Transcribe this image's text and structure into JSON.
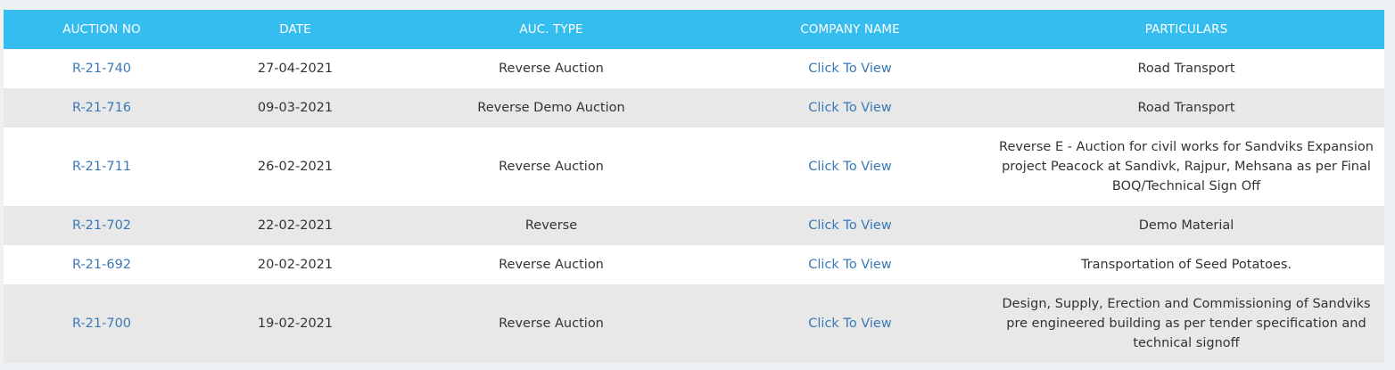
{
  "table": {
    "headers": {
      "auction_no": "AUCTION NO",
      "date": "DATE",
      "auc_type": "AUC. TYPE",
      "company_name": "COMPANY NAME",
      "particulars": "PARTICULARS"
    },
    "rows": [
      {
        "auction_no": "R-21-740",
        "date": "27-04-2021",
        "auc_type": "Reverse Auction",
        "company_name": "Click To View",
        "particulars": "Road Transport"
      },
      {
        "auction_no": "R-21-716",
        "date": "09-03-2021",
        "auc_type": "Reverse Demo Auction",
        "company_name": "Click To View",
        "particulars": "Road Transport"
      },
      {
        "auction_no": "R-21-711",
        "date": "26-02-2021",
        "auc_type": "Reverse Auction",
        "company_name": "Click To View",
        "particulars": "Reverse E - Auction for civil works for Sandviks Expansion project Peacock at Sandivk, Rajpur, Mehsana as per Final BOQ/Technical Sign Off"
      },
      {
        "auction_no": "R-21-702",
        "date": "22-02-2021",
        "auc_type": "Reverse",
        "company_name": "Click To View",
        "particulars": "Demo Material"
      },
      {
        "auction_no": "R-21-692",
        "date": "20-02-2021",
        "auc_type": "Reverse Auction",
        "company_name": "Click To View",
        "particulars": "Transportation of Seed Potatoes."
      },
      {
        "auction_no": "R-21-700",
        "date": "19-02-2021",
        "auc_type": "Reverse Auction",
        "company_name": "Click To View",
        "particulars": "Design, Supply, Erection and Commissioning of Sandviks pre engineered building as per tender specification and technical signoff"
      }
    ]
  },
  "colors": {
    "header_bg": "#35bdf0",
    "header_text": "#ffffff",
    "link": "#3a78b8",
    "row_alt": "#e8e8e8",
    "row": "#ffffff"
  }
}
